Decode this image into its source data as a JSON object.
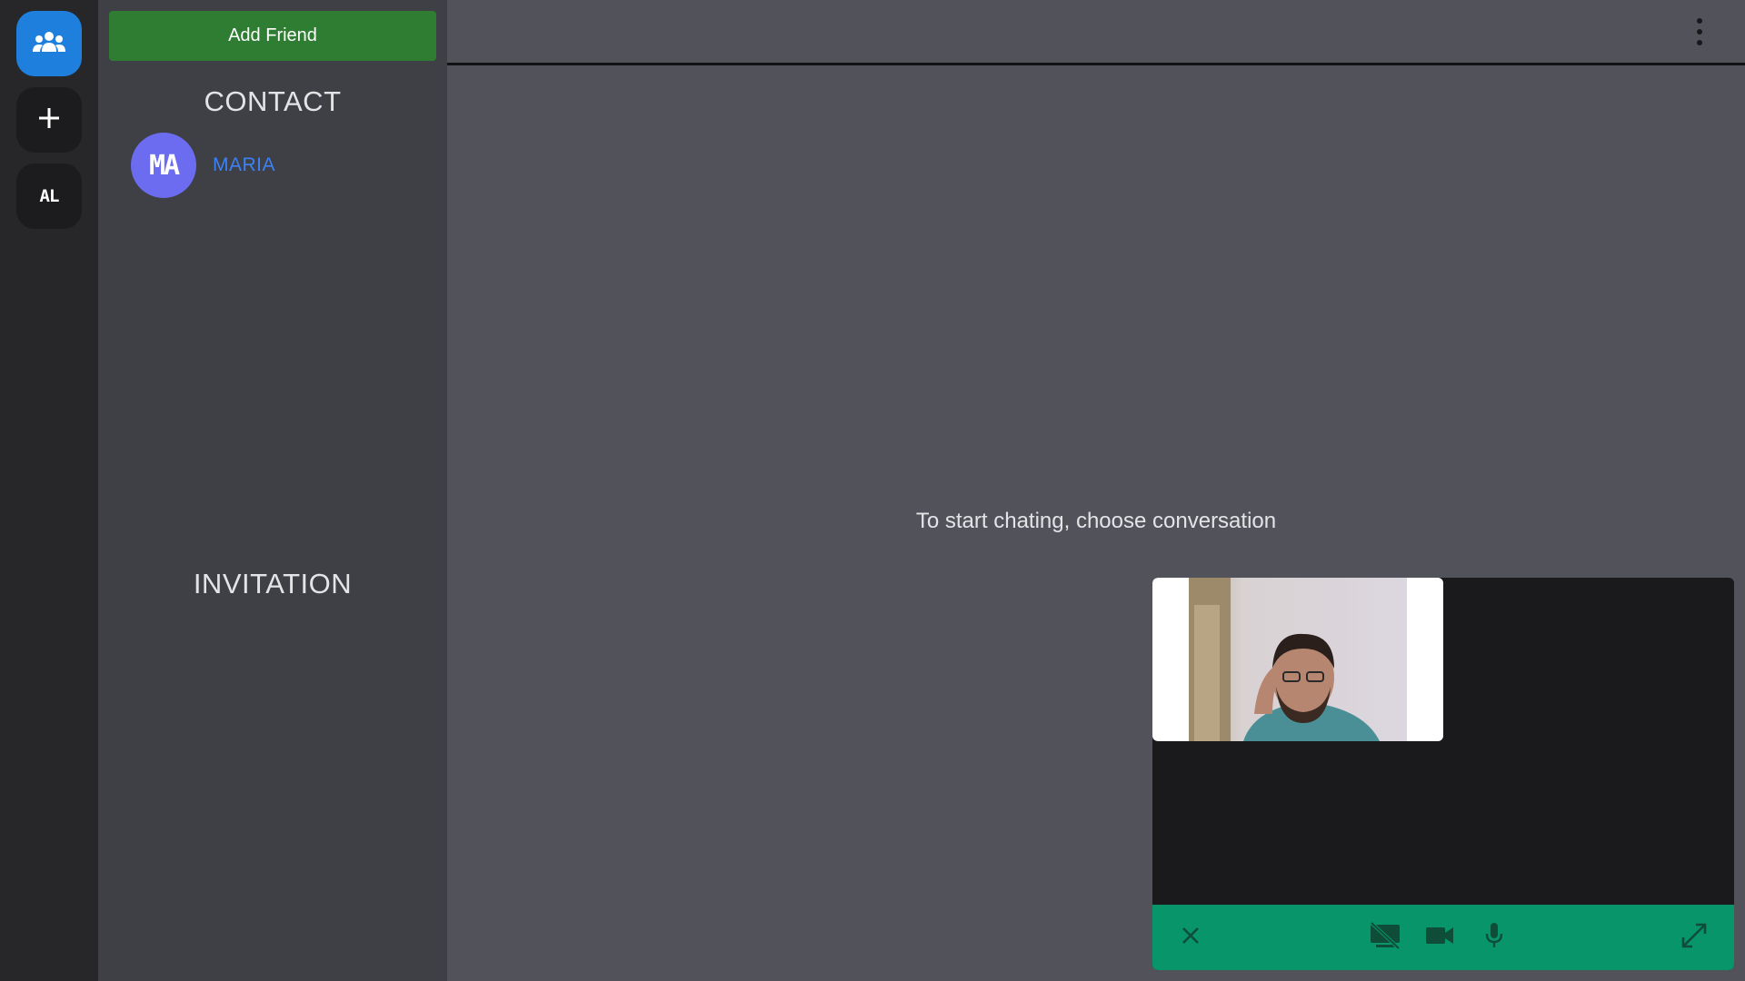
{
  "rail": {
    "items": [
      {
        "icon": "group-icon",
        "active": true
      },
      {
        "icon": "plus-icon",
        "active": false
      },
      {
        "initials": "AL",
        "active": false
      }
    ]
  },
  "panel": {
    "add_friend_label": "Add Friend",
    "contact_title": "CONTACT",
    "contacts": [
      {
        "initials": "MA",
        "name": "MARIA",
        "avatar_color": "#6b6cf0"
      }
    ],
    "invitation_title": "INVITATION"
  },
  "main": {
    "empty_hint": "To start chating, choose conversation",
    "menu_icon": "more-vertical-icon"
  },
  "call": {
    "controls": [
      "close-icon",
      "screen-share-off-icon",
      "videocam-icon",
      "mic-icon",
      "fullscreen-icon"
    ],
    "bar_color": "#08956a"
  },
  "colors": {
    "accent": "#1e7fdc",
    "add_friend": "#2e7d32",
    "contact_name": "#3b82f6"
  }
}
